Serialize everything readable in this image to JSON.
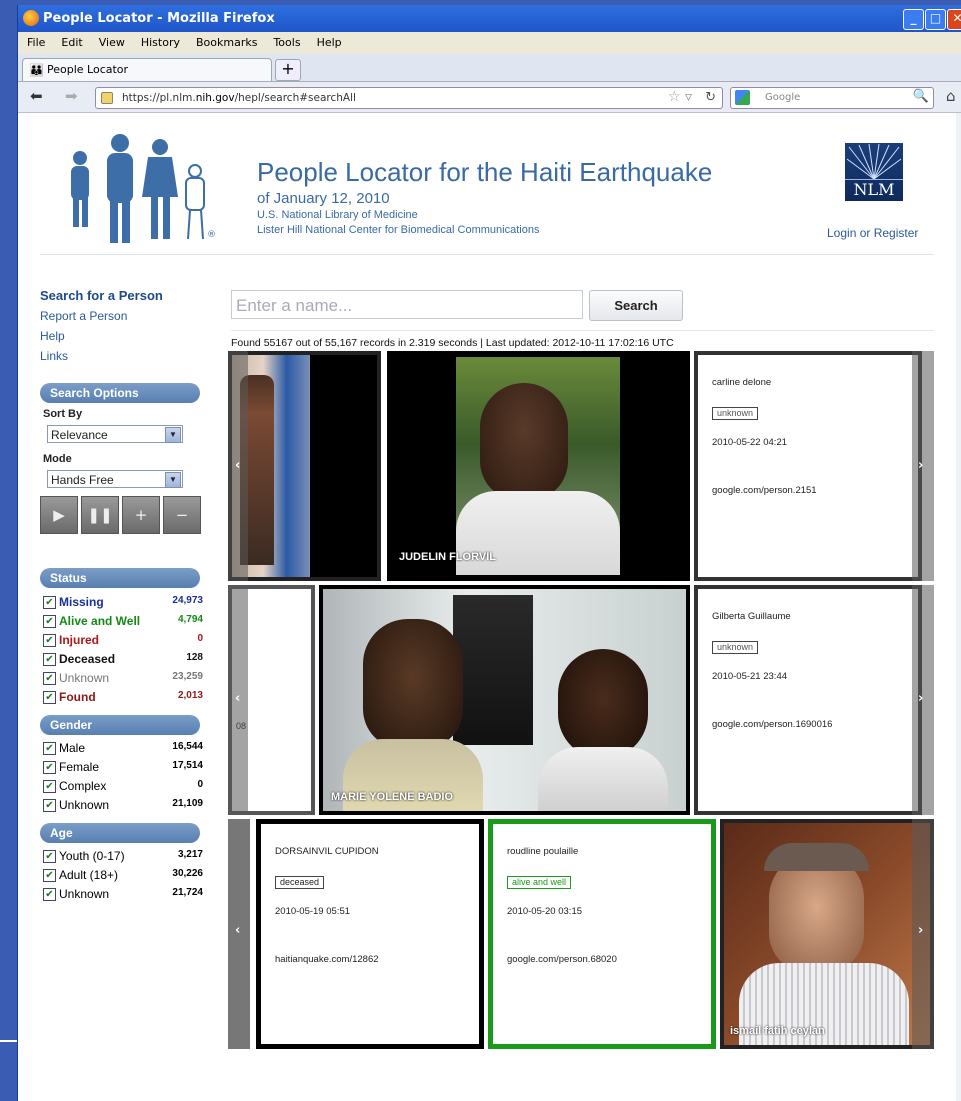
{
  "window": {
    "title": "People Locator - Mozilla Firefox"
  },
  "menu": [
    "File",
    "Edit",
    "View",
    "History",
    "Bookmarks",
    "Tools",
    "Help"
  ],
  "tab": {
    "label": "People Locator"
  },
  "nav": {
    "url_pre": "https://pl.nlm.",
    "url_host": "nih.gov",
    "url_post": "/hepl/search#searchAll",
    "search_placeholder": "Google"
  },
  "header": {
    "title": "People Locator for the Haiti Earthquake",
    "subtitle": "of January 12, 2010",
    "line3": "U.S. National Library of Medicine",
    "line4": "Lister Hill National Center for Biomedical Communications",
    "nlm": "NLM",
    "login": "Login or Register"
  },
  "sidebar": {
    "links": [
      "Search for a Person",
      "Report a Person",
      "Help",
      "Links"
    ],
    "options_title": "Search Options",
    "sort_label": "Sort By",
    "sort_value": "Relevance",
    "mode_label": "Mode",
    "mode_value": "Hands Free",
    "status_title": "Status",
    "status": [
      {
        "name": "Missing",
        "count": "24,973",
        "color": "#1a2f9a"
      },
      {
        "name": "Alive and Well",
        "count": "4,794",
        "color": "#138a13"
      },
      {
        "name": "Injured",
        "count": "0",
        "color": "#b01616"
      },
      {
        "name": "Deceased",
        "count": "128",
        "color": "#111111"
      },
      {
        "name": "Unknown",
        "count": "23,259",
        "color": "#777777"
      },
      {
        "name": "Found",
        "count": "2,013",
        "color": "#8a1a1a"
      }
    ],
    "gender_title": "Gender",
    "gender": [
      {
        "name": "Male",
        "count": "16,544"
      },
      {
        "name": "Female",
        "count": "17,514"
      },
      {
        "name": "Complex",
        "count": "0"
      },
      {
        "name": "Unknown",
        "count": "21,109"
      }
    ],
    "age_title": "Age",
    "age": [
      {
        "name": "Youth (0-17)",
        "count": "3,217"
      },
      {
        "name": "Adult (18+)",
        "count": "30,226"
      },
      {
        "name": "Unknown",
        "count": "21,724"
      }
    ]
  },
  "search": {
    "placeholder": "Enter a name...",
    "button": "Search",
    "found": "Found 55167 out of 55,167 records in 2.319 seconds | Last updated: 2012-10-11 17:02:16 UTC"
  },
  "results": {
    "photo1_name": "JUDELIN FLORVIL",
    "card1": {
      "name": "carline delone",
      "status": "unknown",
      "date": "2010-05-22 04:21",
      "source": "google.com/person.2151"
    },
    "row2_fragment": "08",
    "photo2_name": "MARIE YOLENE BADIO",
    "card2": {
      "name": "Gilberta Guillaume",
      "status": "unknown",
      "date": "2010-05-21 23:44",
      "source": "google.com/person.1690016"
    },
    "card3": {
      "name": "DORSAINVIL CUPIDON",
      "status": "deceased",
      "date": "2010-05-19 05:51",
      "source": "haitianquake.com/12862"
    },
    "card4": {
      "name": "roudline poulaille",
      "status": "alive and well",
      "date": "2010-05-20 03:15",
      "source": "google.com/person.68020"
    },
    "photo3_name": "ismail fatih ceylan"
  }
}
